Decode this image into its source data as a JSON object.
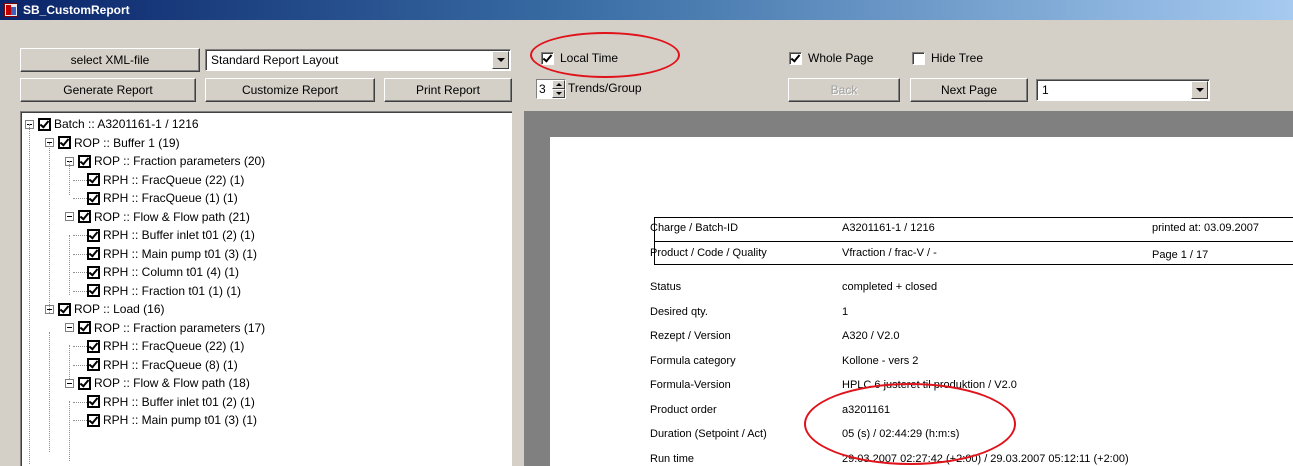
{
  "window": {
    "title": "SB_CustomReport"
  },
  "toolbar": {
    "select_xml": "select XML-file",
    "layout_value": "Standard Report Layout",
    "generate": "Generate Report",
    "customize": "Customize Report",
    "print": "Print Report",
    "local_time": "Local Time",
    "local_time_checked": true,
    "whole_page": "Whole Page",
    "whole_page_checked": true,
    "hide_tree": "Hide Tree",
    "hide_tree_checked": false,
    "trends_value": "3",
    "trends_label": "Trends/Group",
    "back": "Back",
    "next_page": "Next Page",
    "page_value": "1"
  },
  "tree": [
    "Batch :: A3201161-1 / 1216",
    "ROP :: Buffer 1 (19)",
    "ROP :: Fraction parameters (20)",
    "RPH :: FracQueue (22) (1)",
    "RPH :: FracQueue (1) (1)",
    "ROP :: Flow & Flow path (21)",
    "RPH :: Buffer inlet t01 (2) (1)",
    "RPH :: Main pump t01 (3) (1)",
    "RPH :: Column t01 (4) (1)",
    "RPH :: Fraction t01 (1) (1)",
    "ROP :: Load (16)",
    "ROP :: Fraction parameters (17)",
    "RPH :: FracQueue (22) (1)",
    "RPH :: FracQueue (8) (1)",
    "ROP :: Flow & Flow path (18)",
    "RPH :: Buffer inlet t01 (2) (1)",
    "RPH :: Main pump t01 (3) (1)"
  ],
  "report": {
    "header": [
      {
        "label": "Charge / Batch-ID",
        "value": "A3201161-1 / 1216",
        "note": "printed at: 03.09.2007"
      },
      {
        "label": "Product / Code / Quality",
        "value": "Vfraction / frac-V / -",
        "note": "Page 1 / 17"
      }
    ],
    "rows": [
      {
        "label": "Status",
        "value": "completed + closed"
      },
      {
        "label": "Desired qty.",
        "value": "1"
      },
      {
        "label": "Rezept / Version",
        "value": "A320 / V2.0"
      },
      {
        "label": "Formula category",
        "value": "Kollone - vers 2"
      },
      {
        "label": "Formula-Version",
        "value": "HPLC 6 justeret til produktion / V2.0"
      },
      {
        "label": "Product order",
        "value": "a3201161"
      },
      {
        "label": "Duration (Setpoint / Act)",
        "value": "05 (s) / 02:44:29 (h:m:s)"
      },
      {
        "label": "Run time",
        "value": "29.03.2007 02:27:42 (+2:00) / 29.03.2007 05:12:11 (+2:00)"
      }
    ]
  },
  "colors": {
    "annotation": "#e0121a",
    "title_gradient_start": "#0a246a",
    "preview_bg": "#808080"
  }
}
